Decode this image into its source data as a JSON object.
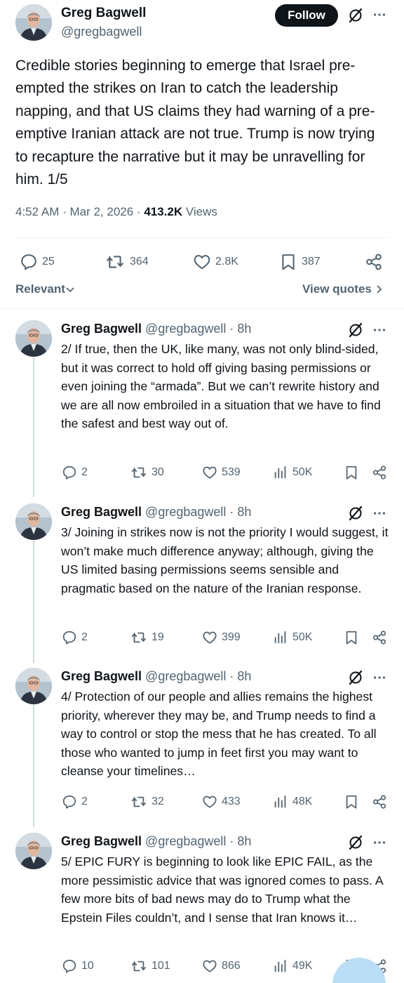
{
  "main": {
    "name": "Greg Bagwell",
    "handle": "@gregbagwell",
    "follow_label": "Follow",
    "text": "Credible stories beginning to emerge that Israel pre-empted the strikes on Iran to catch the leadership napping, and that US claims they had warning of a pre-emptive Iranian attack are not true. Trump is now trying to recapture the narrative but it may be unravelling for him. 1/5",
    "time": "4:52 AM · Mar 2, 2026 · ",
    "views_count": "413.2K",
    "views_label": " Views",
    "replies": "25",
    "reposts": "364",
    "likes": "2.8K",
    "bookmarks": "387"
  },
  "sort": {
    "relevant_label": "Relevant",
    "view_quotes_label": "View quotes"
  },
  "replies": [
    {
      "name": "Greg Bagwell",
      "handle": "@gregbagwell · 8h",
      "text": "2/ If true, then the UK, like many, was not only blind-sided, but it was correct to hold off giving basing permissions or even joining the “armada”. But we can’t rewrite history and we are all now embroiled in a situation that we have to find the safest and best way out of.",
      "replies": "2",
      "reposts": "30",
      "likes": "539",
      "views": "50K"
    },
    {
      "name": "Greg Bagwell",
      "handle": "@gregbagwell · 8h",
      "text": "3/ Joining in strikes now is not the priority I would suggest, it won’t make much difference anyway; although, giving the US limited basing permissions seems sensible and pragmatic based on the nature of the Iranian response.",
      "replies": "2",
      "reposts": "19",
      "likes": "399",
      "views": "50K"
    },
    {
      "name": "Greg Bagwell",
      "handle": "@gregbagwell · 8h",
      "text": "4/ Protection of our people and allies remains the highest priority, wherever they may be, and Trump needs to find a way to control or stop the mess that he has created. To all those who wanted to jump in feet first you may want to cleanse your timelines…",
      "replies": "2",
      "reposts": "32",
      "likes": "433",
      "views": "48K"
    },
    {
      "name": "Greg Bagwell",
      "handle": "@gregbagwell · 8h",
      "text": "5/ EPIC FURY is beginning to look like EPIC FAIL, as the more pessimistic advice that was ignored comes to pass. A few more bits of bad news may do to Trump what the Epstein Files couldn’t, and I sense that Iran knows it…",
      "replies": "10",
      "reposts": "101",
      "likes": "866",
      "views": "49K"
    }
  ],
  "icons": [
    "avatar",
    "grok-icon",
    "more-icon",
    "reply-icon",
    "repost-icon",
    "like-icon",
    "bookmark-icon",
    "share-icon",
    "views-icon",
    "chevron-down-icon",
    "chevron-right-icon"
  ],
  "colors": {
    "text": "#0f1419",
    "secondary": "#536471",
    "button": "#0f1419",
    "thread_line": "#cfd9de",
    "fab": "#b9def5"
  }
}
